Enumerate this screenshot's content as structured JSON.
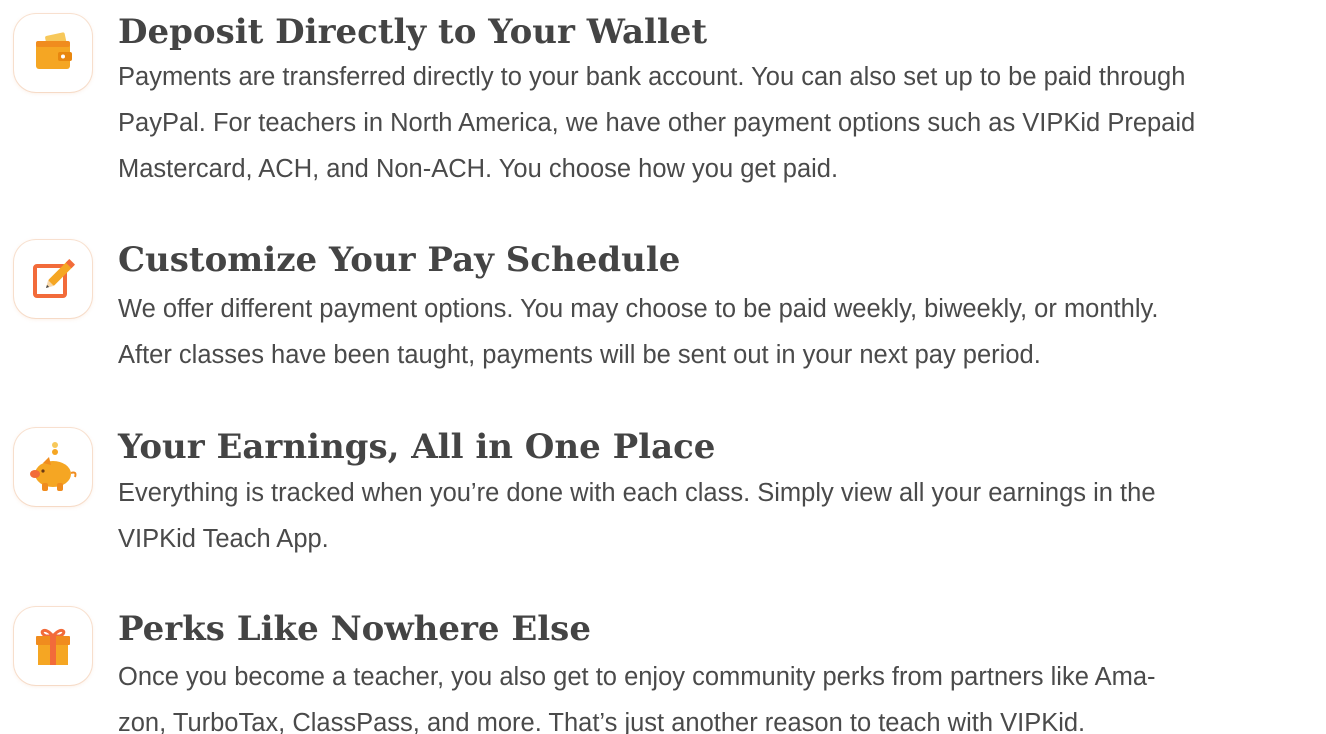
{
  "colors": {
    "accent_orange": "#f5a623",
    "accent_red_orange": "#f26b3a",
    "title_text": "#444444",
    "body_text": "#4a4a4a",
    "tile_border": "#f8e2d2"
  },
  "features": [
    {
      "icon": "wallet-icon",
      "title": "Deposit Directly to Your Wallet",
      "lines": [
        "Payments are transferred directly to your bank account. You can also set up to be paid through",
        "PayPal. For teachers in North America, we have other payment options such as VIPKid Prepaid",
        "Mastercard, ACH, and Non-ACH. You choose how you get paid."
      ]
    },
    {
      "icon": "edit-pencil-icon",
      "title": "Customize Your Pay Schedule",
      "lines": [
        "We offer different payment options. You may choose to be paid weekly, biweekly, or monthly.",
        "After classes have been taught, payments will be sent out in your next pay period."
      ]
    },
    {
      "icon": "piggy-bank-icon",
      "title": "Your Earnings, All in One Place",
      "lines": [
        "Everything is tracked when you’re done with each class. Simply view all your earnings in the",
        "VIPKid Teach App."
      ]
    },
    {
      "icon": "gift-icon",
      "title": "Perks Like Nowhere Else",
      "lines": [
        "Once you become a teacher, you also get to enjoy community perks from partners like Ama-",
        "zon, TurboTax, ClassPass, and more. That’s just another reason to teach with VIPKid."
      ]
    }
  ]
}
